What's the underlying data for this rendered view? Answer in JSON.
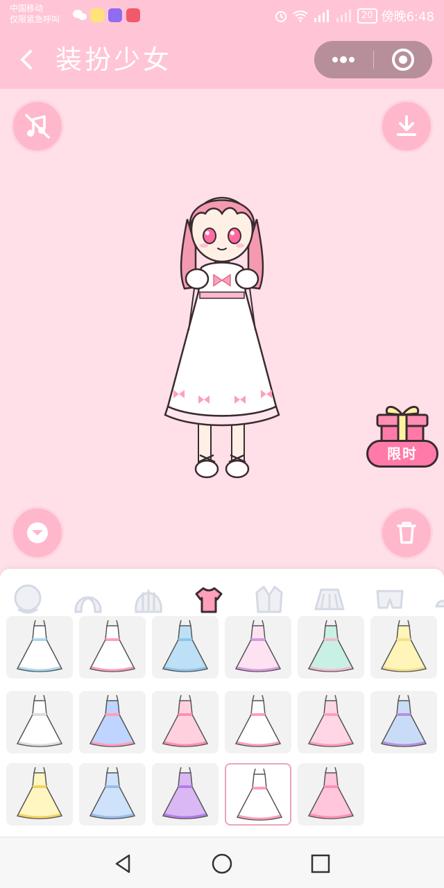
{
  "status_bar": {
    "carrier_line1": "中国移动",
    "carrier_line2": "仅限紧急呼叫",
    "battery": "20",
    "time": "傍晚6:48"
  },
  "app": {
    "title": "装扮少女",
    "gift_label": "限时"
  },
  "colors": {
    "header_pink": "#ffc5d6",
    "stage_pink": "#ffdfe8",
    "button_pink": "#ffb7cc",
    "accent_pink": "#ff7aa8",
    "tab_active": "#ff9fba",
    "tab_inactive": "#d5d9e4"
  },
  "icons": {
    "back": "chevron-left-icon",
    "more": "more-dots-icon",
    "close": "target-close-icon",
    "music_off": "music-off-icon",
    "download": "download-icon",
    "collapse": "chevron-down-icon",
    "trash": "trash-icon",
    "gift": "gift-icon"
  },
  "tabs": [
    {
      "name": "face",
      "active": false
    },
    {
      "name": "hair-front",
      "active": false
    },
    {
      "name": "hair-back",
      "active": false
    },
    {
      "name": "top",
      "active": true
    },
    {
      "name": "jacket",
      "active": false
    },
    {
      "name": "skirt",
      "active": false
    },
    {
      "name": "shorts",
      "active": false
    },
    {
      "name": "shoes",
      "active": false
    }
  ],
  "dresses": [
    {
      "style": "white-bow",
      "color": "#ffffff",
      "accent": "#a8d8f0"
    },
    {
      "style": "white-ribbon",
      "color": "#ffffff",
      "accent": "#ff9fb9"
    },
    {
      "style": "blue-bow",
      "color": "#bde0f7",
      "accent": "#8ec5ea"
    },
    {
      "style": "pink-lace",
      "color": "#fde3f2",
      "accent": "#d99be0"
    },
    {
      "style": "mint-sailor",
      "color": "#c9f0e4",
      "accent": "#f6b8cf"
    },
    {
      "style": "yellow-puff",
      "color": "#fff5b8",
      "accent": "#f6e08c"
    },
    {
      "style": "white-slip",
      "color": "#ffffff",
      "accent": "#dddddd"
    },
    {
      "style": "blue-sash",
      "color": "#bfd4ff",
      "accent": "#ff9fb9"
    },
    {
      "style": "pink-overall",
      "color": "#ffd1df",
      "accent": "#ff8fae"
    },
    {
      "style": "white-pink-bow",
      "color": "#ffffff",
      "accent": "#ff9fb9"
    },
    {
      "style": "pink-gown",
      "color": "#ffd6e6",
      "accent": "#ff9fb9"
    },
    {
      "style": "rainbow-hem",
      "color": "#c9dcf7",
      "accent": "#b990e0"
    },
    {
      "style": "yellow-long",
      "color": "#fff6c2",
      "accent": "#f2d35e"
    },
    {
      "style": "blue-long",
      "color": "#cfe2fb",
      "accent": "#9bbde8"
    },
    {
      "style": "purple-gradient",
      "color": "#d9b8f5",
      "accent": "#b07ee6"
    },
    {
      "style": "white-bows-selected",
      "color": "#ffffff",
      "accent": "#ff9fb9",
      "selected": true
    },
    {
      "style": "pink-mermaid",
      "color": "#ffc6dc",
      "accent": "#ff8fb6"
    }
  ]
}
